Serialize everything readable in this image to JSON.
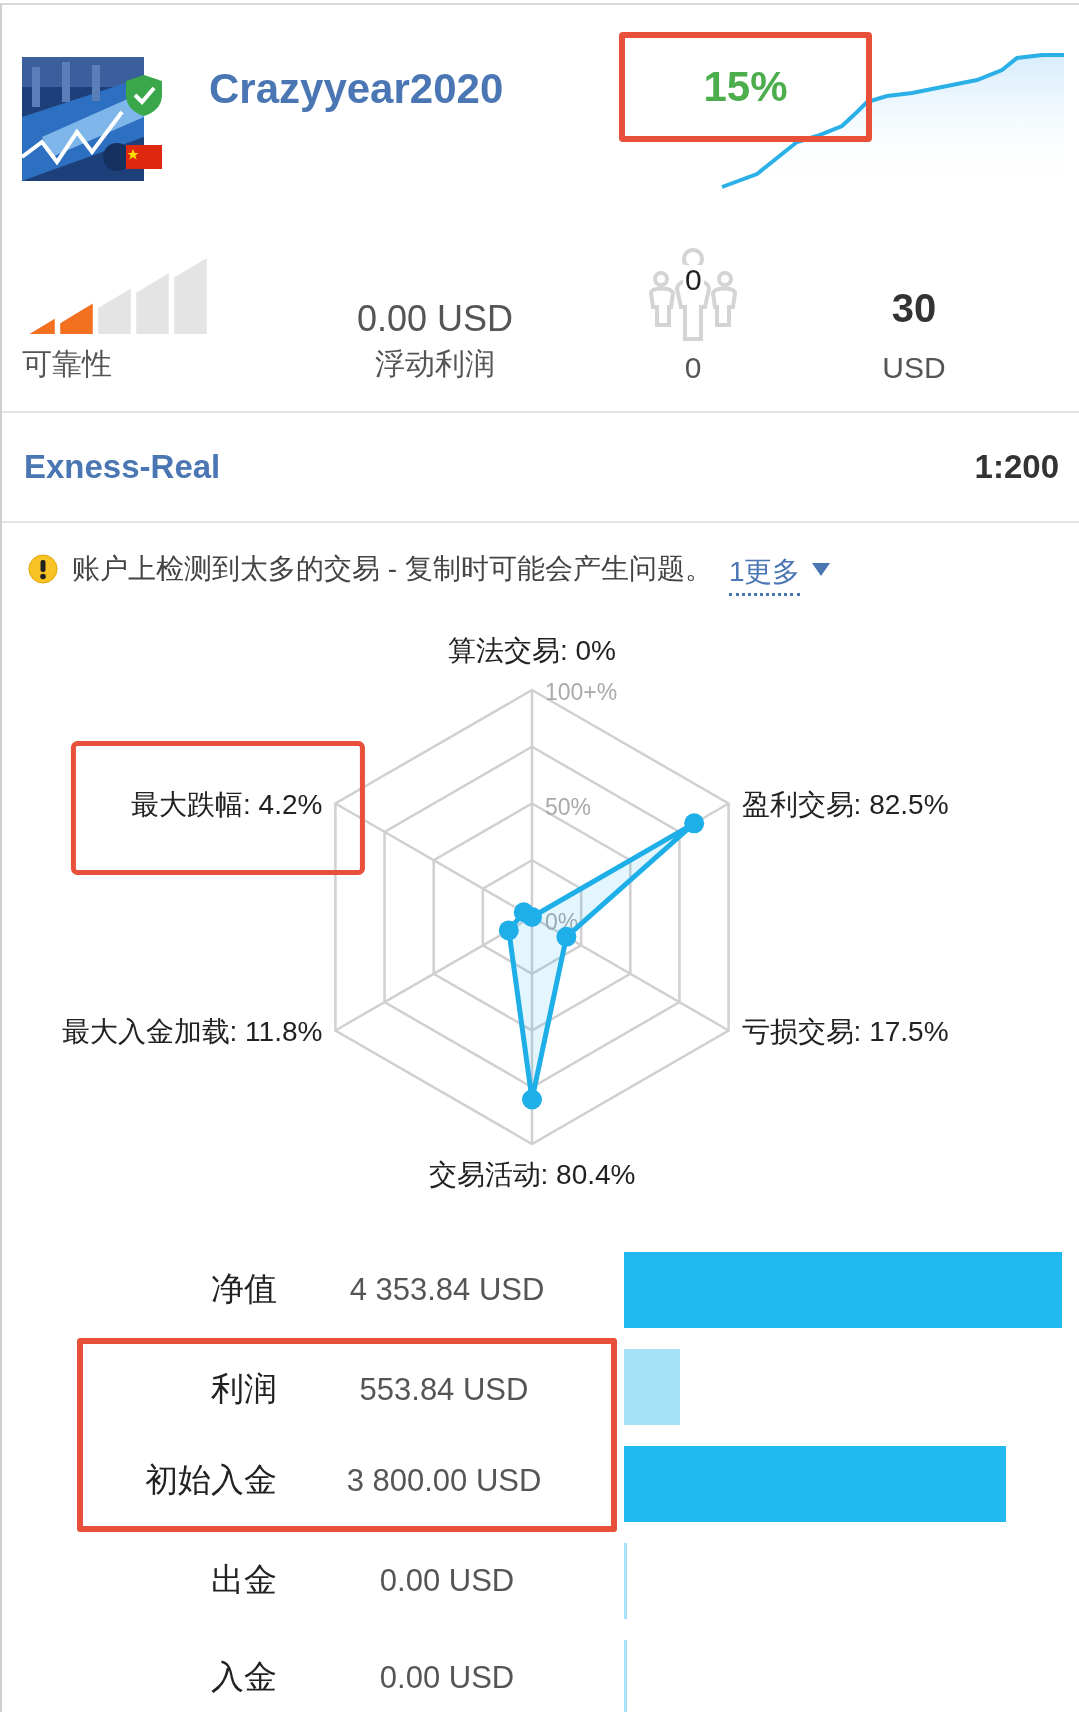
{
  "header": {
    "name": "Crazyyear2020",
    "growth": {
      "text": "15%",
      "highlighted": true
    }
  },
  "stats": {
    "reliability": {
      "level": 0.4,
      "label": "可靠性"
    },
    "floating": {
      "value": "0.00 USD",
      "label": "浮动利润"
    },
    "subscribers": {
      "icon_count": "0",
      "label": "0"
    },
    "price": {
      "value": "30",
      "label": "USD"
    }
  },
  "broker": {
    "name": "Exness-Real",
    "leverage": "1:200"
  },
  "warning": {
    "text": "账户上检测到太多的交易 - 复制时可能会产生问题。",
    "more_link": "1更多"
  },
  "radar": {
    "ring_labels": [
      "100+%",
      "50%",
      "0%"
    ],
    "axes": [
      {
        "label": "算法交易: 0%",
        "highlighted": false
      },
      {
        "label": "最大跌幅: 4.2%",
        "highlighted": true
      },
      {
        "label": "盈利交易: 82.5%",
        "highlighted": false
      },
      {
        "label": "最大入金加载: 11.8%",
        "highlighted": false
      },
      {
        "label": "亏损交易: 17.5%",
        "highlighted": false
      },
      {
        "label": "交易活动: 80.4%",
        "highlighted": false
      }
    ]
  },
  "balances": [
    {
      "label": "净值",
      "value": "4 353.84 USD",
      "color": "#22b8f0",
      "highlighted": false
    },
    {
      "label": "利润",
      "value": "553.84 USD",
      "color": "#a8e2f8",
      "highlighted": true
    },
    {
      "label": "初始入金",
      "value": "3 800.00 USD",
      "color": "#22b8f0",
      "highlighted": true
    },
    {
      "label": "出金",
      "value": "0.00 USD",
      "color": "#a8e2f8",
      "highlighted": false
    },
    {
      "label": "入金",
      "value": "0.00 USD",
      "color": "#a8e2f8",
      "highlighted": false
    }
  ]
}
